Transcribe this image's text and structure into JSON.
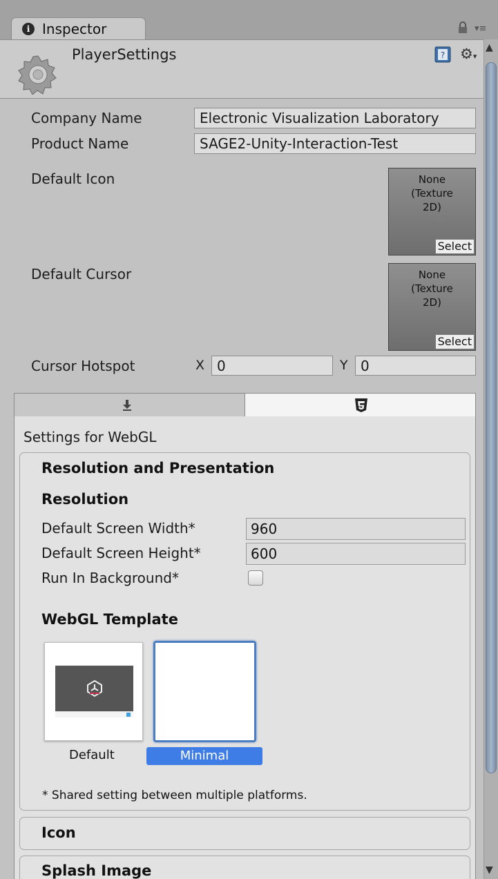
{
  "window": {
    "tab_label": "Inspector",
    "menu_glyph": "▾≡"
  },
  "header": {
    "title": "PlayerSettings"
  },
  "fields": {
    "company_label": "Company Name",
    "company_value": "Electronic Visualization Laboratory",
    "product_label": "Product Name",
    "product_value": "SAGE2-Unity-Interaction-Test",
    "default_icon_label": "Default Icon",
    "default_cursor_label": "Default Cursor",
    "object_none_line1": "None",
    "object_none_line2": "(Texture",
    "object_none_line3": "2D)",
    "select_label": "Select",
    "cursor_hotspot_label": "Cursor Hotspot",
    "hotspot_x_label": "X",
    "hotspot_x_value": "0",
    "hotspot_y_label": "Y",
    "hotspot_y_value": "0"
  },
  "platform_tabs": {
    "tab1_icon": "download-arrow-icon",
    "tab2_icon": "html5-icon",
    "selected": "WebGL"
  },
  "webgl": {
    "settings_for": "Settings for WebGL",
    "resolution_presentation": "Resolution and Presentation",
    "resolution": "Resolution",
    "width_label": "Default Screen Width*",
    "width_value": "960",
    "height_label": "Default Screen Height*",
    "height_value": "600",
    "run_bg_label": "Run In Background*",
    "run_bg_checked": false,
    "template_heading": "WebGL Template",
    "template_default": "Default",
    "template_minimal": "Minimal",
    "template_selected": "Minimal",
    "shared_note": "* Shared setting between multiple platforms.",
    "icon_section": "Icon",
    "splash_section": "Splash Image"
  },
  "colors": {
    "selection_blue": "#3f7de6",
    "scroll_thumb": "#8fa2b8"
  }
}
